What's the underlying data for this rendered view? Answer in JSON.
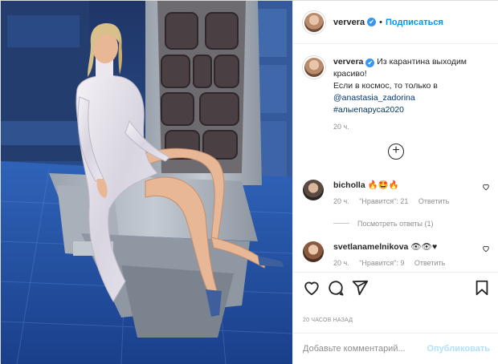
{
  "post": {
    "username": "ververa",
    "verified_mark": "✔",
    "separator": "•",
    "follow_label": "Подписаться"
  },
  "caption": {
    "username": "ververa",
    "line1": "Из карантина выходим красиво!",
    "line2": "Если в космос, то только в",
    "mention": "@anastasia_zadorina",
    "hashtag": "#алыепаруса2020",
    "time": "20 ч."
  },
  "load_more_icon": "plus-circle-icon",
  "comments": [
    {
      "username": "bicholla",
      "text": "🔥🤩🔥",
      "time": "20 ч.",
      "likes": "\"Нравится\": 21",
      "reply_label": "Ответить",
      "view_replies": "Посмотреть ответы (1)"
    },
    {
      "username": "svetlanamelnikova",
      "text": "👁👁♥",
      "time": "20 ч.",
      "likes": "\"Нравится\": 9",
      "reply_label": "Ответить"
    }
  ],
  "actions": {
    "icons": [
      "heart-icon",
      "comment-icon",
      "share-icon",
      "bookmark-icon"
    ]
  },
  "post_time": "20 ЧАСОВ НАЗАД",
  "add_comment": {
    "placeholder": "Добавьте комментарий...",
    "publish_label": "Опубликовать"
  },
  "colors": {
    "link": "#0095f6",
    "verified": "#3897f0",
    "muted": "#8e8e8e",
    "publish_disabled": "#b2dffc"
  }
}
